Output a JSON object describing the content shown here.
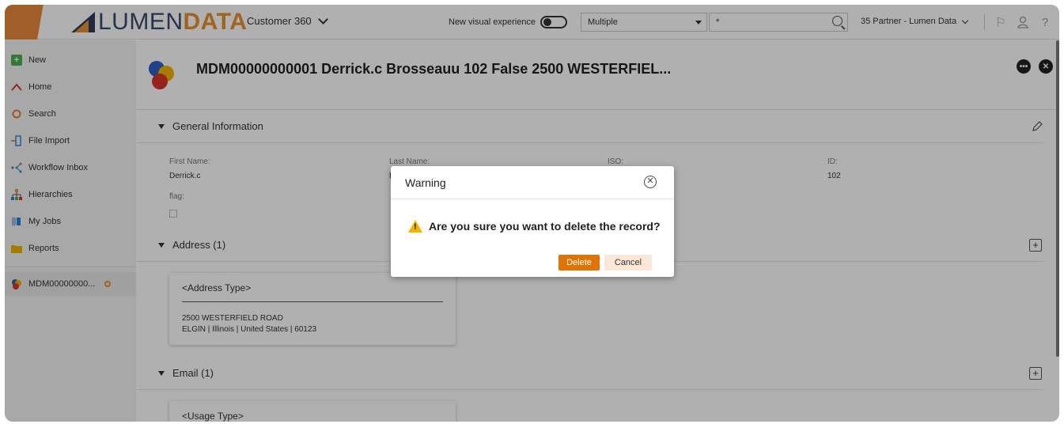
{
  "topbar": {
    "logo_part1": "LUMEN",
    "logo_part2": "DATA",
    "app_name": "Customer 360",
    "new_visual_label": "New visual experience",
    "select_value": "Multiple",
    "search_value": "*",
    "partner_label": "35 Partner - Lumen Data"
  },
  "sidebar": {
    "items": [
      {
        "label": "New",
        "icon": "plus-icon"
      },
      {
        "label": "Home",
        "icon": "home-icon"
      },
      {
        "label": "Search",
        "icon": "search-icon"
      },
      {
        "label": "File Import",
        "icon": "file-import-icon"
      },
      {
        "label": "Workflow Inbox",
        "icon": "workflow-icon"
      },
      {
        "label": "Hierarchies",
        "icon": "hierarchy-icon"
      },
      {
        "label": "My Jobs",
        "icon": "jobs-icon"
      },
      {
        "label": "Reports",
        "icon": "folder-icon"
      }
    ],
    "open_record": "MDM00000000..."
  },
  "record": {
    "title": "MDM00000000001 Derrick.c Brosseauu 102 False 2500 WESTERFIEL..."
  },
  "general": {
    "heading": "General Information",
    "first_name_label": "First Name:",
    "first_name_value": "Derrick.c",
    "last_name_label": "Last Name:",
    "last_name_value": "B",
    "iso_label": "ISO:",
    "id_label": "ID:",
    "id_value": "102",
    "flag_label": "flag:"
  },
  "address": {
    "heading": "Address (1)",
    "card_title": "<Address Type>",
    "line1": "2500 WESTERFIELD ROAD",
    "line2": "ELGIN | Illinois | United States | 60123"
  },
  "email": {
    "heading": "Email (1)",
    "card_title": "<Usage Type>"
  },
  "dialog": {
    "title": "Warning",
    "message": "Are you sure you want to delete the record?",
    "delete_label": "Delete",
    "cancel_label": "Cancel"
  },
  "colors": {
    "accent": "#e07306",
    "logo_orange": "#e8902f",
    "logo_navy": "#3a4b6d"
  }
}
